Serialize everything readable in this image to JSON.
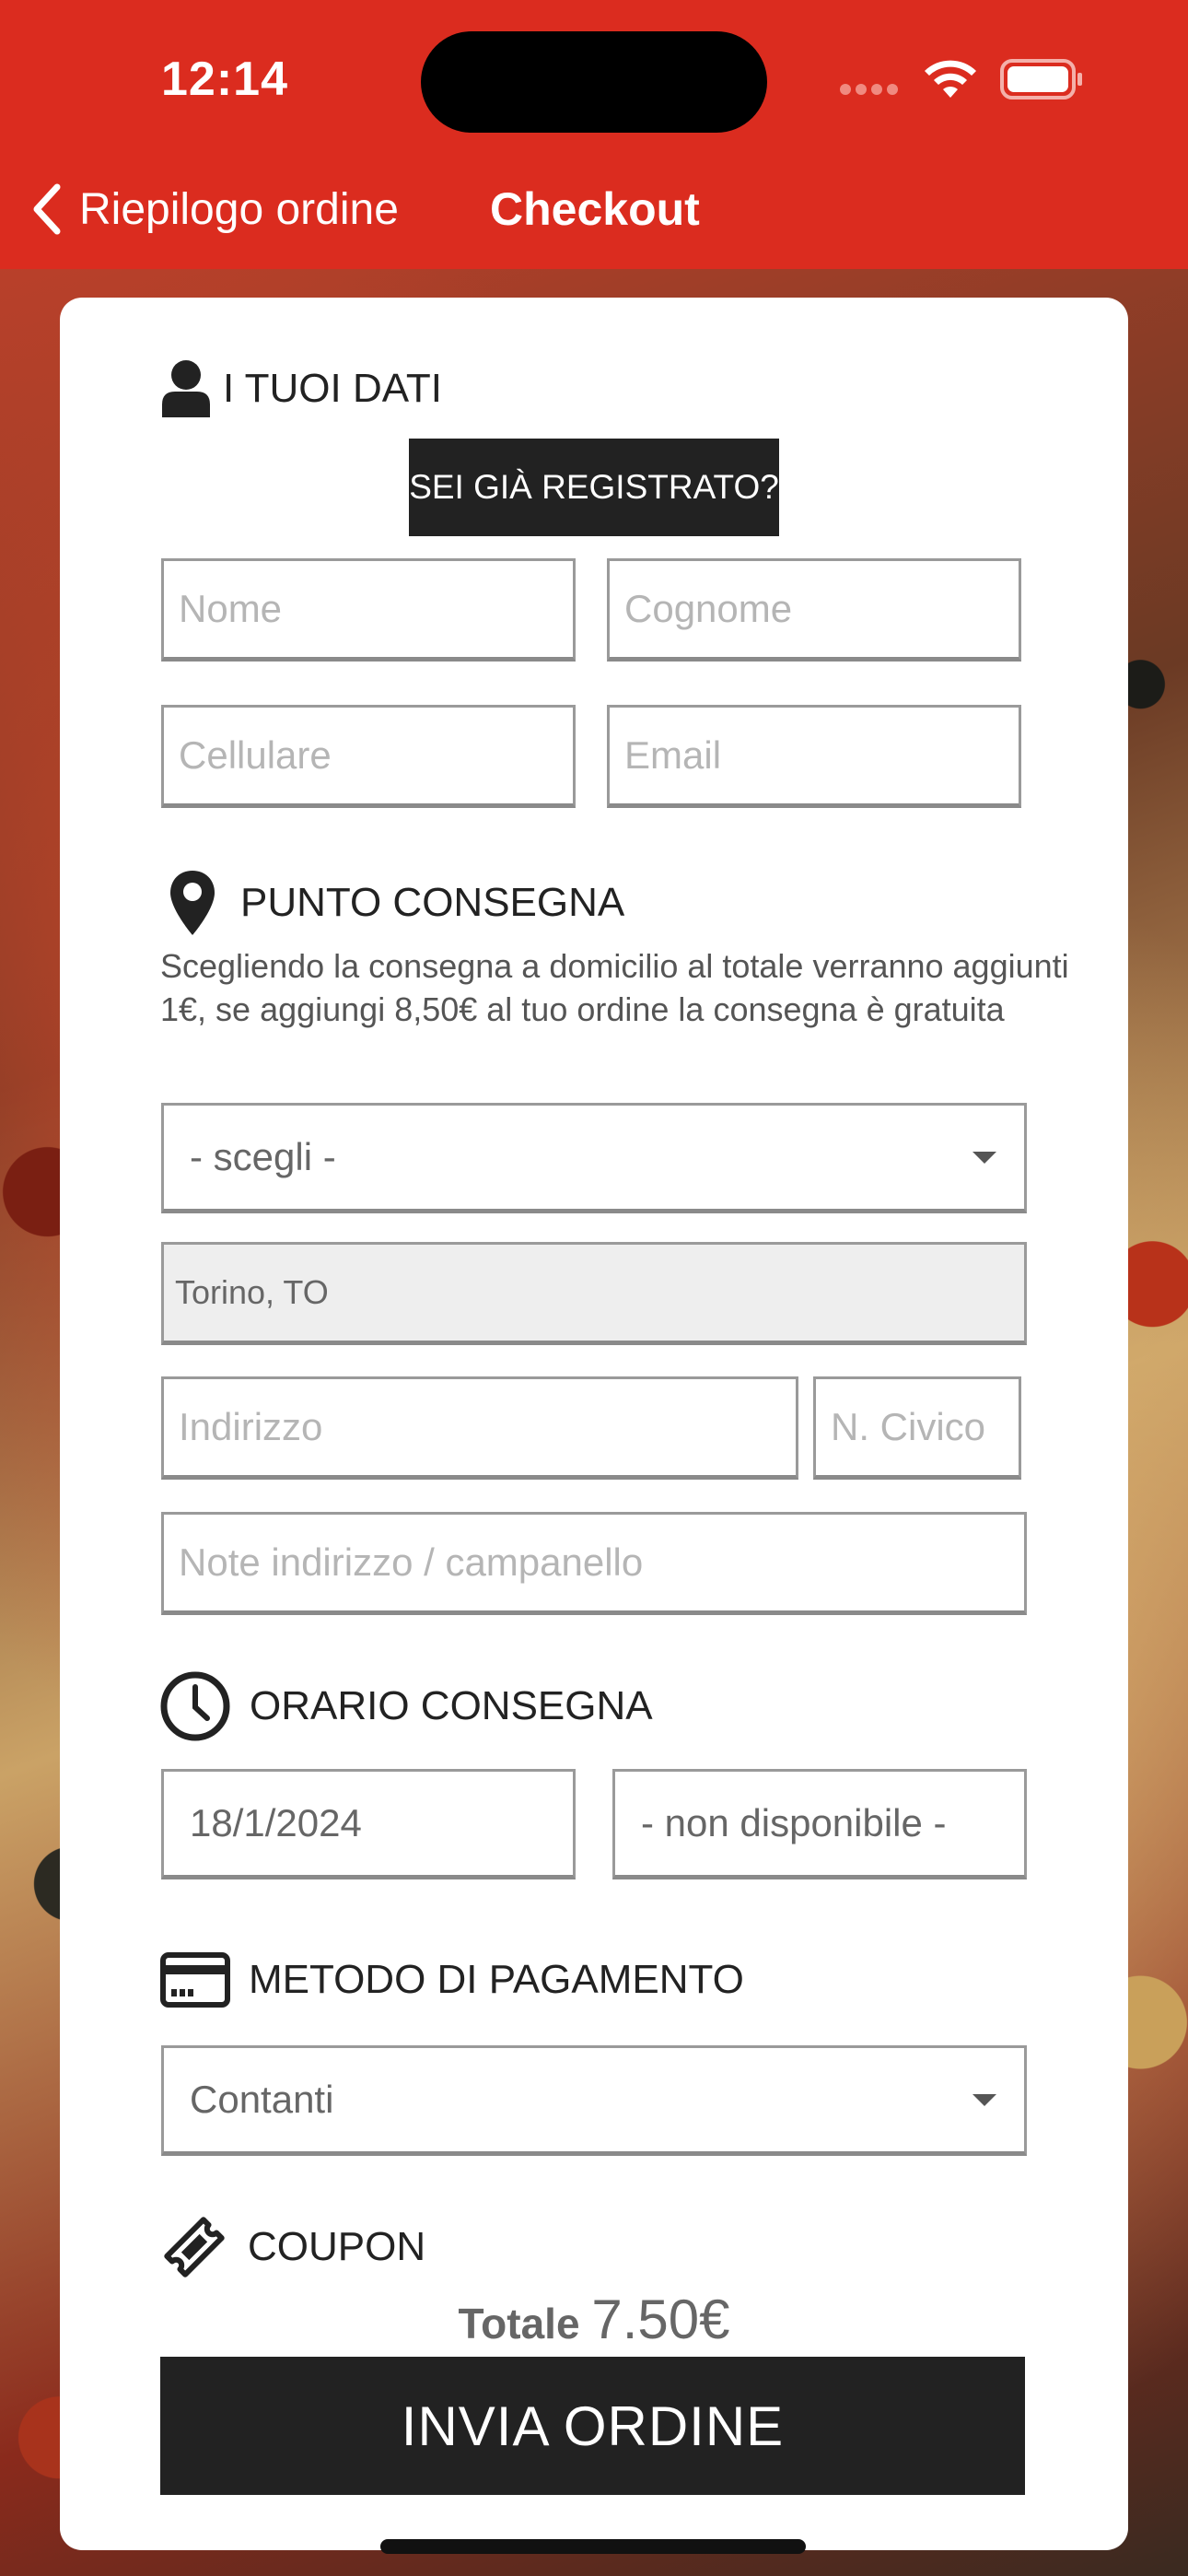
{
  "status_bar": {
    "time": "12:14"
  },
  "nav": {
    "back_label": "Riepilogo ordine",
    "title": "Checkout"
  },
  "colors": {
    "accent": "#db2c1f",
    "button_dark": "#222222",
    "card": "#ffffff"
  },
  "personal": {
    "heading": "I TUOI DATI",
    "registered_button": "SEI GIÀ REGISTRATO?",
    "name_placeholder": "Nome",
    "surname_placeholder": "Cognome",
    "phone_placeholder": "Cellulare",
    "email_placeholder": "Email"
  },
  "delivery": {
    "heading": "PUNTO CONSEGNA",
    "note": "Scegliendo la consegna a domicilio al totale verranno aggiunti 1€, se aggiungi 8,50€ al tuo ordine la consegna è gratuita",
    "select_value": "- scegli -",
    "city_value": "Torino, TO",
    "address_placeholder": "Indirizzo",
    "number_placeholder": "N. Civico",
    "notes_placeholder": "Note indirizzo / campanello"
  },
  "schedule": {
    "heading": "ORARIO CONSEGNA",
    "date_value": "18/1/2024",
    "time_value": "- non disponibile -"
  },
  "payment": {
    "heading": "METODO DI PAGAMENTO",
    "method_value": "Contanti"
  },
  "coupon": {
    "heading": "COUPON"
  },
  "summary": {
    "total_label": "Totale",
    "total_value": "7.50€",
    "submit_label": "INVIA ORDINE"
  },
  "icons": [
    "user-icon",
    "location-pin-icon",
    "clock-icon",
    "credit-card-icon",
    "ticket-icon",
    "chevron-left-icon",
    "wifi-icon",
    "battery-icon"
  ]
}
